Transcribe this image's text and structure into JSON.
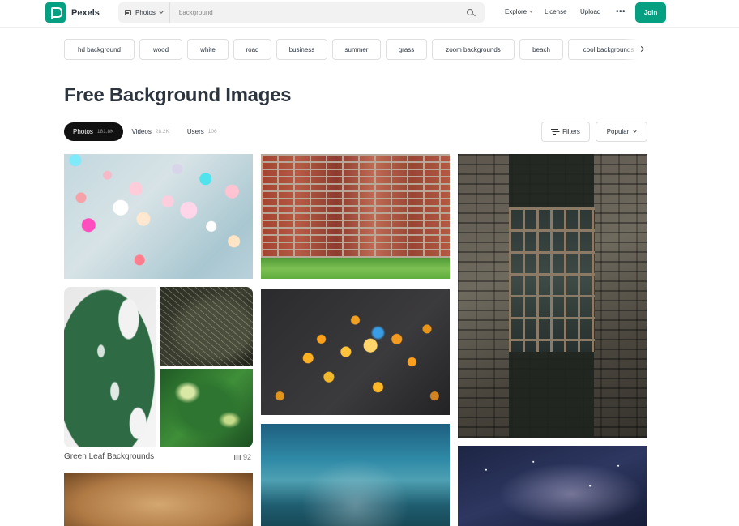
{
  "header": {
    "brand": "Pexels",
    "search": {
      "type_label": "Photos",
      "query": "background"
    },
    "nav": {
      "explore": "Explore",
      "license": "License",
      "upload": "Upload",
      "more": "•••"
    },
    "join_label": "Join"
  },
  "tags": [
    "hd background",
    "wood",
    "white",
    "road",
    "business",
    "summer",
    "grass",
    "zoom backgrounds",
    "beach",
    "cool backgrounds"
  ],
  "page_title": "Free Background Images",
  "media_tabs": [
    {
      "label": "Photos",
      "count": "181.8K",
      "active": true
    },
    {
      "label": "Videos",
      "count": "28.2K",
      "active": false
    },
    {
      "label": "Users",
      "count": "106",
      "active": false
    }
  ],
  "controls": {
    "filters_label": "Filters",
    "sort_label": "Popular"
  },
  "collection": {
    "title": "Green Leaf Backgrounds",
    "count": "92"
  },
  "photos": [
    "pastel-bokeh",
    "brick-wall-grass",
    "barred-window",
    "monstera-leaf",
    "dark-leaf",
    "green-leaves",
    "golden-bokeh",
    "rainy-street",
    "starry-sky",
    "parchment"
  ],
  "colors": {
    "brand": "#05a081",
    "text": "#2c343e",
    "active_tab": "#111111"
  }
}
